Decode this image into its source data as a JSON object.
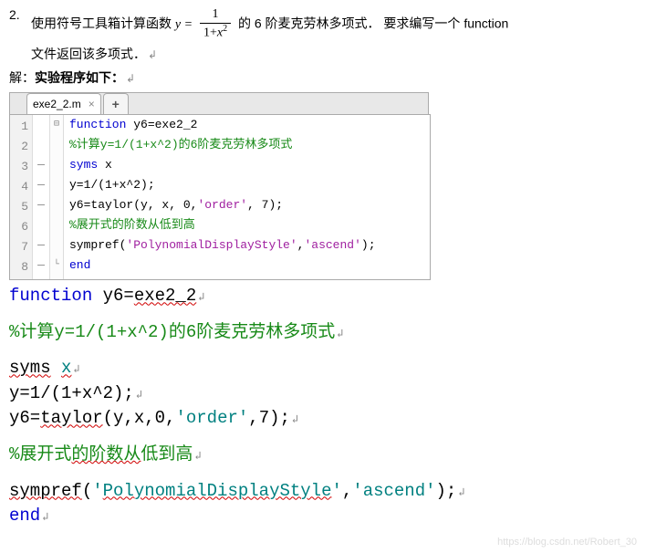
{
  "problem": {
    "number": "2.",
    "part1": "使用符号工具箱计算函数 ",
    "eq_lhs": "y =",
    "frac_top": "1",
    "frac_bot_pre": "1+",
    "frac_bot_var": "x",
    "frac_bot_sup": "2",
    "part2": " 的 6 阶麦克劳林多项式．  要求编写一个 function",
    "line2": "文件返回该多项式．"
  },
  "answer_label_pre": "解：",
  "answer_label_bold": "实验程序如下：",
  "tab": {
    "filename": "exe2_2.m",
    "close": "×",
    "plus": "+"
  },
  "editor": {
    "lines": [
      "1",
      "2",
      "3",
      "4",
      "5",
      "6",
      "7",
      "8"
    ],
    "dashes": [
      "",
      "",
      "—",
      "—",
      "—",
      "",
      "—",
      "—"
    ],
    "folds": [
      "⊟",
      "",
      "",
      "",
      "",
      "",
      "",
      "└"
    ],
    "code": {
      "l1a": "function",
      "l1b": " y6=exe2_2",
      "l2": "%计算y=1/(1+x^2)的6阶麦克劳林多项式",
      "l3a": "syms",
      "l3b": " x",
      "l4": "y=1/(1+x^2);",
      "l5a": "y6=taylor(y, x, 0,",
      "l5b": "'order'",
      "l5c": ", 7);",
      "l6": "%展开式的阶数从低到高",
      "l7a": "sympref(",
      "l7b": "'PolynomialDisplayStyle'",
      "l7c": ",",
      "l7d": "'ascend'",
      "l7e": ");",
      "l8": "end"
    }
  },
  "plaincode": {
    "l1a": "function",
    "l1b": " y6=",
    "l1c": "exe2_2",
    "l2a": "%计算y=1/(1+x^2)的6阶麦克劳林多项式",
    "l3a": "syms",
    "l3b": " ",
    "l3c": "x",
    "l4": "y=1/(1+x^2);",
    "l5a": "y6=",
    "l5b": "taylor",
    "l5c": "(y,x,0,",
    "l5d": "'order'",
    "l5e": ",7);",
    "l6a": "%展开式",
    "l6b": "的阶数从",
    "l6c": "低到高",
    "l7a": "sympref",
    "l7b": "(",
    "l7c": "'",
    "l7d": "PolynomialDisplayStyle",
    "l7e": "'",
    "l7f": ",",
    "l7g": "'ascend'",
    "l7h": ");",
    "l8": "end"
  },
  "retmark": "↲",
  "watermark": "https://blog.csdn.net/Robert_30"
}
